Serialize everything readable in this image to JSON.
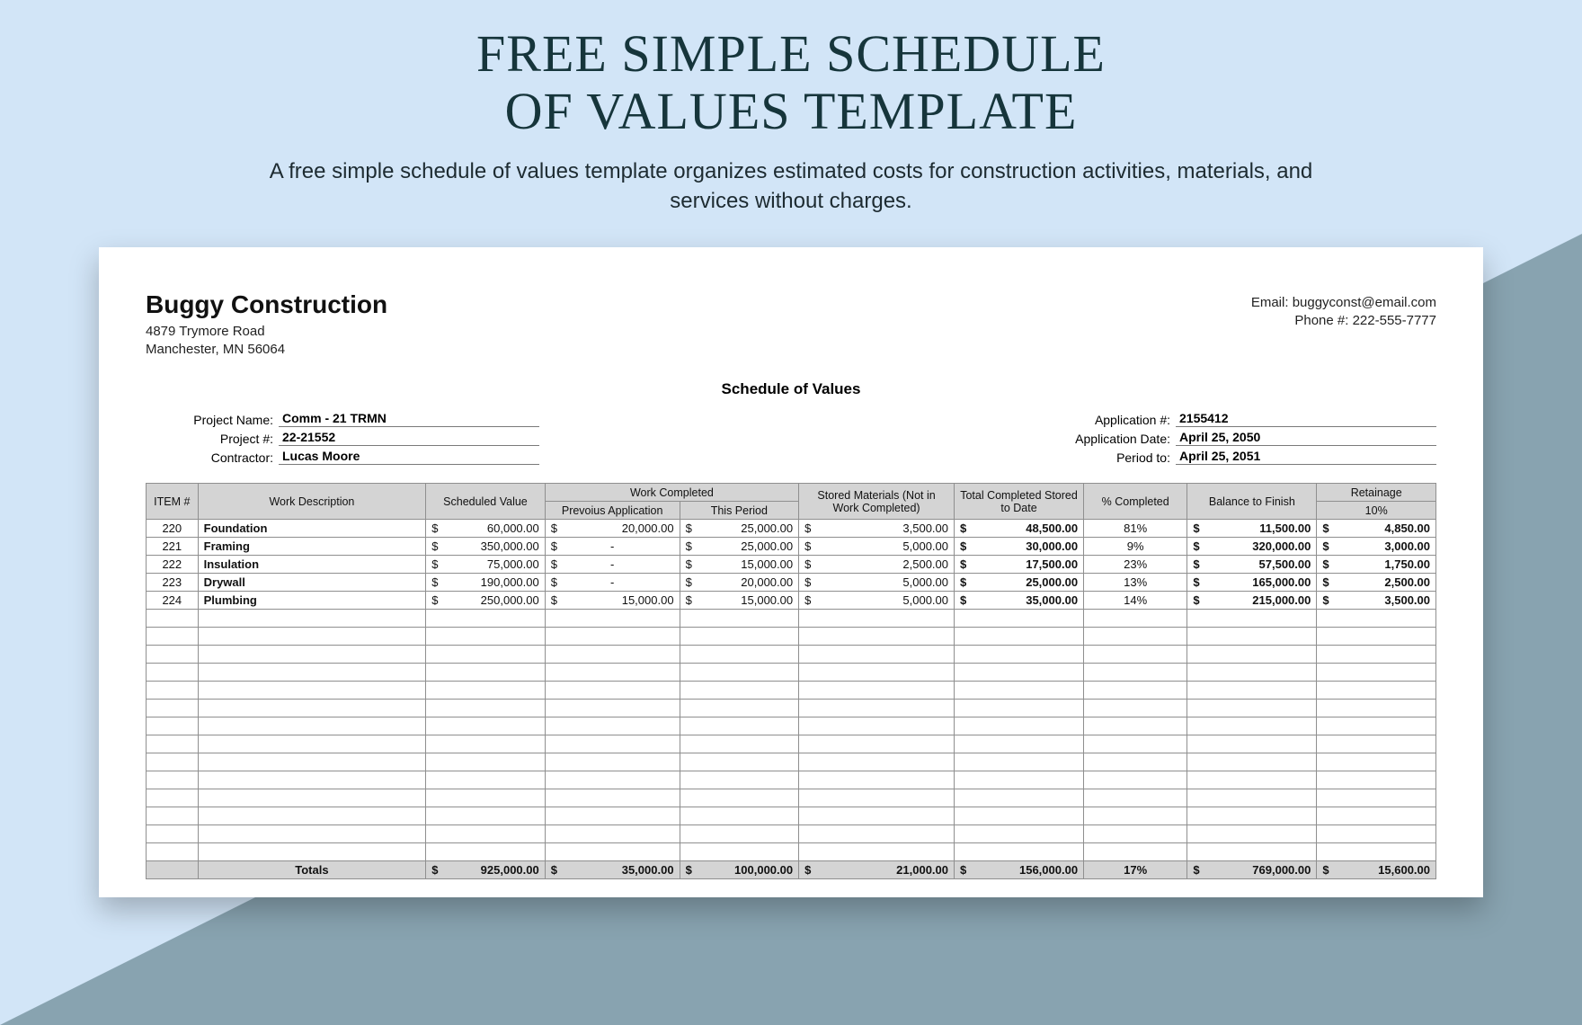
{
  "heading": {
    "title_l1": "FREE SIMPLE SCHEDULE",
    "title_l2": "OF VALUES TEMPLATE",
    "desc": "A free simple schedule of values template organizes estimated costs for construction activities, materials, and services without charges."
  },
  "company": {
    "name": "Buggy Construction",
    "addr1": "4879 Trymore Road",
    "addr2": "Manchester, MN 56064",
    "email_label": "Email: ",
    "email": "buggyconst@email.com",
    "phone_label": "Phone #: ",
    "phone": "222-555-7777"
  },
  "sov_title": "Schedule of Values",
  "meta": {
    "left": [
      {
        "label": "Project Name:",
        "val": "Comm - 21 TRMN"
      },
      {
        "label": "Project #:",
        "val": "22-21552"
      },
      {
        "label": "Contractor:",
        "val": "Lucas Moore"
      }
    ],
    "right": [
      {
        "label": "Application #:",
        "val": "2155412"
      },
      {
        "label": "Application Date:",
        "val": "April 25, 2050"
      },
      {
        "label": "Period to:",
        "val": "April 25, 2051"
      }
    ]
  },
  "headers": {
    "item": "ITEM #",
    "desc": "Work Description",
    "sched": "Scheduled Value",
    "work_completed": "Work Completed",
    "prev": "Prevoius Application",
    "this": "This Period",
    "stored": "Stored Materials (Not in Work Completed)",
    "total": "Total Completed Stored to Date",
    "pct": "% Completed",
    "bal": "Balance to Finish",
    "ret": "Retainage",
    "ret_pct": "10%"
  },
  "rows": [
    {
      "item": "220",
      "desc": "Foundation",
      "sched": "60,000.00",
      "prev": "20,000.00",
      "this": "25,000.00",
      "stored": "3,500.00",
      "total": "48,500.00",
      "pct": "81%",
      "bal": "11,500.00",
      "ret": "4,850.00"
    },
    {
      "item": "221",
      "desc": "Framing",
      "sched": "350,000.00",
      "prev": "-",
      "this": "25,000.00",
      "stored": "5,000.00",
      "total": "30,000.00",
      "pct": "9%",
      "bal": "320,000.00",
      "ret": "3,000.00"
    },
    {
      "item": "222",
      "desc": "Insulation",
      "sched": "75,000.00",
      "prev": "-",
      "this": "15,000.00",
      "stored": "2,500.00",
      "total": "17,500.00",
      "pct": "23%",
      "bal": "57,500.00",
      "ret": "1,750.00"
    },
    {
      "item": "223",
      "desc": "Drywall",
      "sched": "190,000.00",
      "prev": "-",
      "this": "20,000.00",
      "stored": "5,000.00",
      "total": "25,000.00",
      "pct": "13%",
      "bal": "165,000.00",
      "ret": "2,500.00"
    },
    {
      "item": "224",
      "desc": "Plumbing",
      "sched": "250,000.00",
      "prev": "15,000.00",
      "this": "15,000.00",
      "stored": "5,000.00",
      "total": "35,000.00",
      "pct": "14%",
      "bal": "215,000.00",
      "ret": "3,500.00"
    }
  ],
  "empty_rows": 14,
  "totals": {
    "label": "Totals",
    "sched": "925,000.00",
    "prev": "35,000.00",
    "this": "100,000.00",
    "stored": "21,000.00",
    "total": "156,000.00",
    "pct": "17%",
    "bal": "769,000.00",
    "ret": "15,600.00"
  }
}
